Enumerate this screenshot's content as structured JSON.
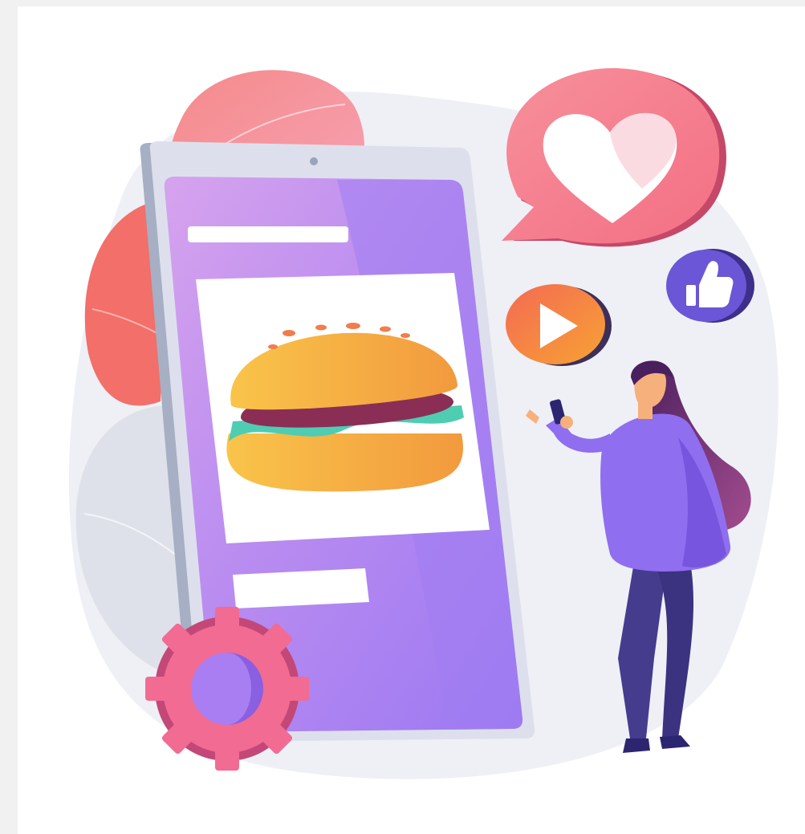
{
  "illustration": {
    "subject": "food-ordering-social-media-illustration",
    "icons": [
      "heart-icon",
      "play-icon",
      "thumbs-up-icon",
      "gear-icon",
      "burger-icon",
      "smartphone-icon"
    ]
  },
  "colors": {
    "page_bg": "#f1f1f2",
    "frame_bg": "#ffffff",
    "blob": "#eef0f6",
    "phone_body": "#d9dbe8",
    "phone_screen": "#b98cf0",
    "heart_bubble": "#f57b8a",
    "play_circle": "#f5803e",
    "thumb_circle": "#6a56d6",
    "gear": "#f26b92",
    "person_top": "#8f6ef0",
    "person_pants": "#453c8e",
    "hair": "#6a2c6e",
    "skin": "#f6b07c"
  }
}
